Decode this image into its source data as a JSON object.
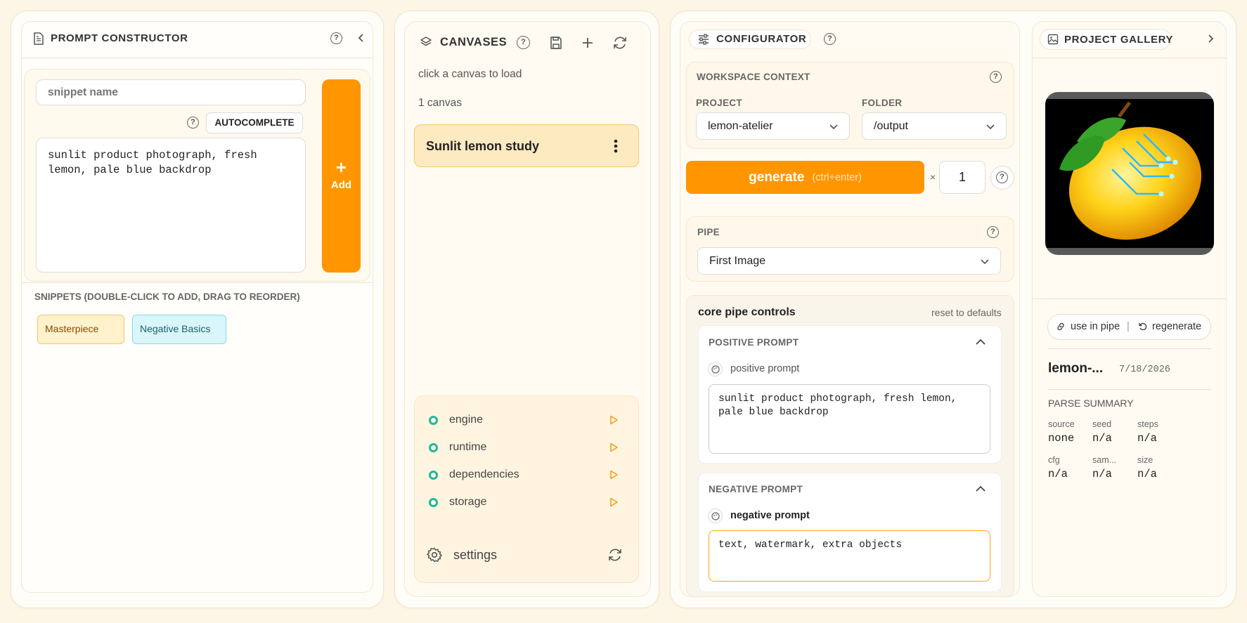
{
  "prompt_constructor": {
    "title": "PROMPT CONSTRUCTOR",
    "snippet_name_placeholder": "snippet name",
    "autocomplete_label": "AUTOCOMPLETE",
    "prompt_text": "sunlit product photograph, fresh lemon, pale blue backdrop",
    "add_label": "Add",
    "add_glyph": "+",
    "snippets_heading": "SNIPPETS (DOUBLE-CLICK TO ADD, DRAG TO REORDER)",
    "snippets": [
      "Masterpiece",
      "Negative Basics"
    ]
  },
  "canvases": {
    "title": "CANVASES",
    "hint": "click a canvas to load",
    "count": "1 canvas",
    "items": [
      {
        "name": "Sunlit lemon study"
      }
    ],
    "status_items": [
      "engine",
      "runtime",
      "dependencies",
      "storage"
    ],
    "settings_label": "settings"
  },
  "configurator": {
    "title": "CONFIGURATOR",
    "workspace_context": "WORKSPACE CONTEXT",
    "project_label": "PROJECT",
    "project_value": "lemon-atelier",
    "folder_label": "FOLDER",
    "folder_value": "/output",
    "generate_label": "generate",
    "generate_shortcut": "(ctrl+enter)",
    "multiplier_symbol": "×",
    "batch_count": "1",
    "pipe_label": "PIPE",
    "pipe_value": "First Image",
    "core_controls_title": "core pipe controls",
    "reset_label": "reset to defaults",
    "positive_section": "POSITIVE PROMPT",
    "positive_field_label": "positive prompt",
    "positive_value": "sunlit product photograph, fresh lemon, pale blue backdrop",
    "negative_section": "NEGATIVE PROMPT",
    "negative_field_label": "negative prompt",
    "negative_value": "text, watermark, extra objects"
  },
  "gallery": {
    "title": "PROJECT GALLERY",
    "use_in_pipe": "use in pipe",
    "separator": "|",
    "regenerate": "regenerate",
    "image_name": "lemon-...",
    "image_date": "7/18/2026",
    "parse_summary_title": "PARSE SUMMARY",
    "summary": [
      {
        "label": "source",
        "value": "none"
      },
      {
        "label": "seed",
        "value": "n/a"
      },
      {
        "label": "steps",
        "value": "n/a"
      },
      {
        "label": "cfg",
        "value": "n/a"
      },
      {
        "label": "sam...",
        "value": "n/a"
      },
      {
        "label": "size",
        "value": "n/a"
      }
    ]
  },
  "colors": {
    "accent": "#ff9600",
    "status_ok": "#22b892",
    "selected_canvas": "#fdeac0"
  }
}
